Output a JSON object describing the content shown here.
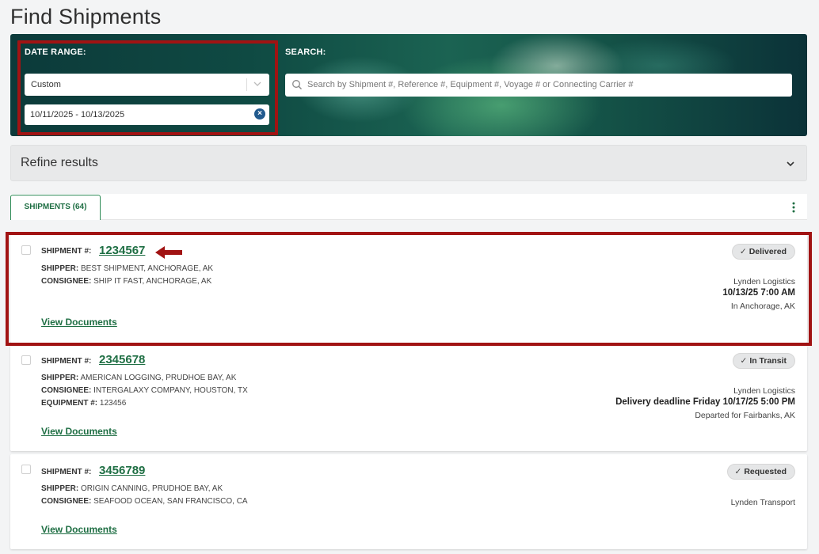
{
  "page": {
    "title": "Find Shipments"
  },
  "filters": {
    "date_range_label": "DATE RANGE:",
    "date_range_value": "Custom",
    "date_value": "10/11/2025 - 10/13/2025",
    "search_label": "SEARCH:",
    "search_placeholder": "Search by Shipment #, Reference #, Equipment #, Voyage # or Connecting Carrier #"
  },
  "refine": {
    "label": "Refine results"
  },
  "tabs": [
    {
      "label": "SHIPMENTS (64)"
    }
  ],
  "shipments": [
    {
      "shipment_label": "SHIPMENT #:",
      "number": "1234567",
      "shipper_label": "SHIPPER:",
      "shipper": "BEST SHIPMENT, ANCHORAGE, AK",
      "consignee_label": "CONSIGNEE:",
      "consignee": "SHIP IT FAST, ANCHORAGE, AK",
      "status": "Delivered",
      "carrier": "Lynden Logistics",
      "datetime": "10/13/25 7:00 AM",
      "location": "In Anchorage, AK",
      "view_documents": "View Documents"
    },
    {
      "shipment_label": "SHIPMENT #:",
      "number": "2345678",
      "shipper_label": "SHIPPER:",
      "shipper": "AMERICAN LOGGING, PRUDHOE BAY, AK",
      "consignee_label": "CONSIGNEE:",
      "consignee": "INTERGALAXY COMPANY, HOUSTON, TX",
      "equipment_label": "EQUIPMENT #:",
      "equipment": "123456",
      "status": "In Transit",
      "carrier": "Lynden Logistics",
      "datetime": "Delivery deadline Friday 10/17/25 5:00 PM",
      "location": "Departed for Fairbanks, AK",
      "view_documents": "View Documents"
    },
    {
      "shipment_label": "SHIPMENT #:",
      "number": "3456789",
      "shipper_label": "SHIPPER:",
      "shipper": "ORIGIN CANNING, PRUDHOE BAY, AK",
      "consignee_label": "CONSIGNEE:",
      "consignee": "SEAFOOD OCEAN, SAN FRANCISCO, CA",
      "status": "Requested",
      "carrier": "Lynden Transport",
      "view_documents": "View Documents"
    }
  ],
  "icons": {
    "status_check": "✓",
    "clear": "×",
    "search": "search-icon",
    "chevron": "chevron-down-icon",
    "more": "kebab-icon",
    "pointer": "arrow-icon"
  },
  "colors": {
    "accent": "#1f6f44",
    "highlight": "#a11313"
  }
}
